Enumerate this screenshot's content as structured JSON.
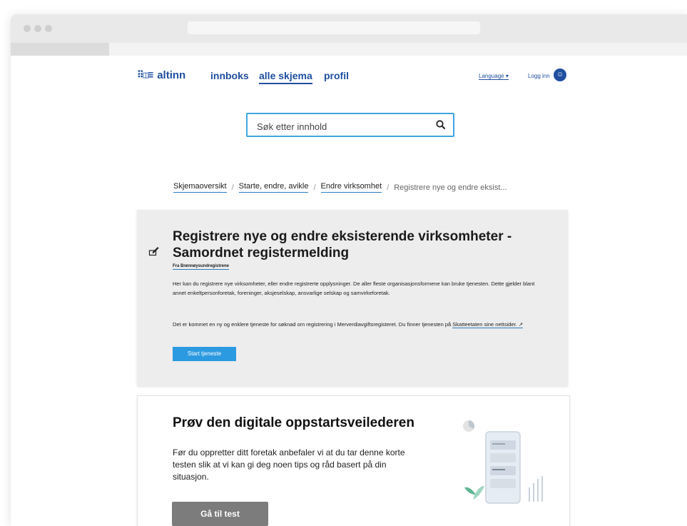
{
  "nav": {
    "logo_text": "altinn",
    "items": [
      {
        "label": "innboks"
      },
      {
        "label": "alle skjema"
      },
      {
        "label": "profil"
      }
    ],
    "language_label": "Language ▾",
    "login_label": "Logg inn"
  },
  "search": {
    "placeholder": "Søk etter innhold"
  },
  "breadcrumb": {
    "items": [
      {
        "label": "Skjemaoversikt"
      },
      {
        "label": "Starte, endre, avikle"
      },
      {
        "label": "Endre virksomhet"
      },
      {
        "label": "Registrere nye og endre eksist..."
      }
    ],
    "separator": "/"
  },
  "main_card": {
    "title": "Registrere nye og endre eksisterende virksomheter - Samordnet registermelding",
    "from_label": "Fra Brønnøysundregistrene",
    "paragraph1": "Her kan du registrere nye virksomheter, eller endre registrerte opplysninger. De aller fleste organisasjonsformene kan bruke tjenesten. Dette gjelder blant annet enkeltpersonforetak, foreninger, aksjeselskap, ansvarlige selskap og samvirkeforetak.",
    "paragraph2_text": "Det er kommet en ny og enklere tjeneste for søknad om registrering i Merverdiavgiftsregisteret. Du finner tjenesten på ",
    "paragraph2_link": "Skatteetaten sine nettsider. ↗",
    "start_button": "Start tjeneste"
  },
  "guide_card": {
    "title": "Prøv den digitale oppstartsveilederen",
    "text": "Før du oppretter ditt foretak anbefaler vi at du tar denne korte testen slik at vi kan gi deg noen tips og råd basert på din situasjon.",
    "button": "Gå til test"
  },
  "colors": {
    "brand": "#1f4fa0",
    "accent": "#2c9ae0",
    "card_bg": "#ededed",
    "secondary_button": "#7c7c7c"
  }
}
